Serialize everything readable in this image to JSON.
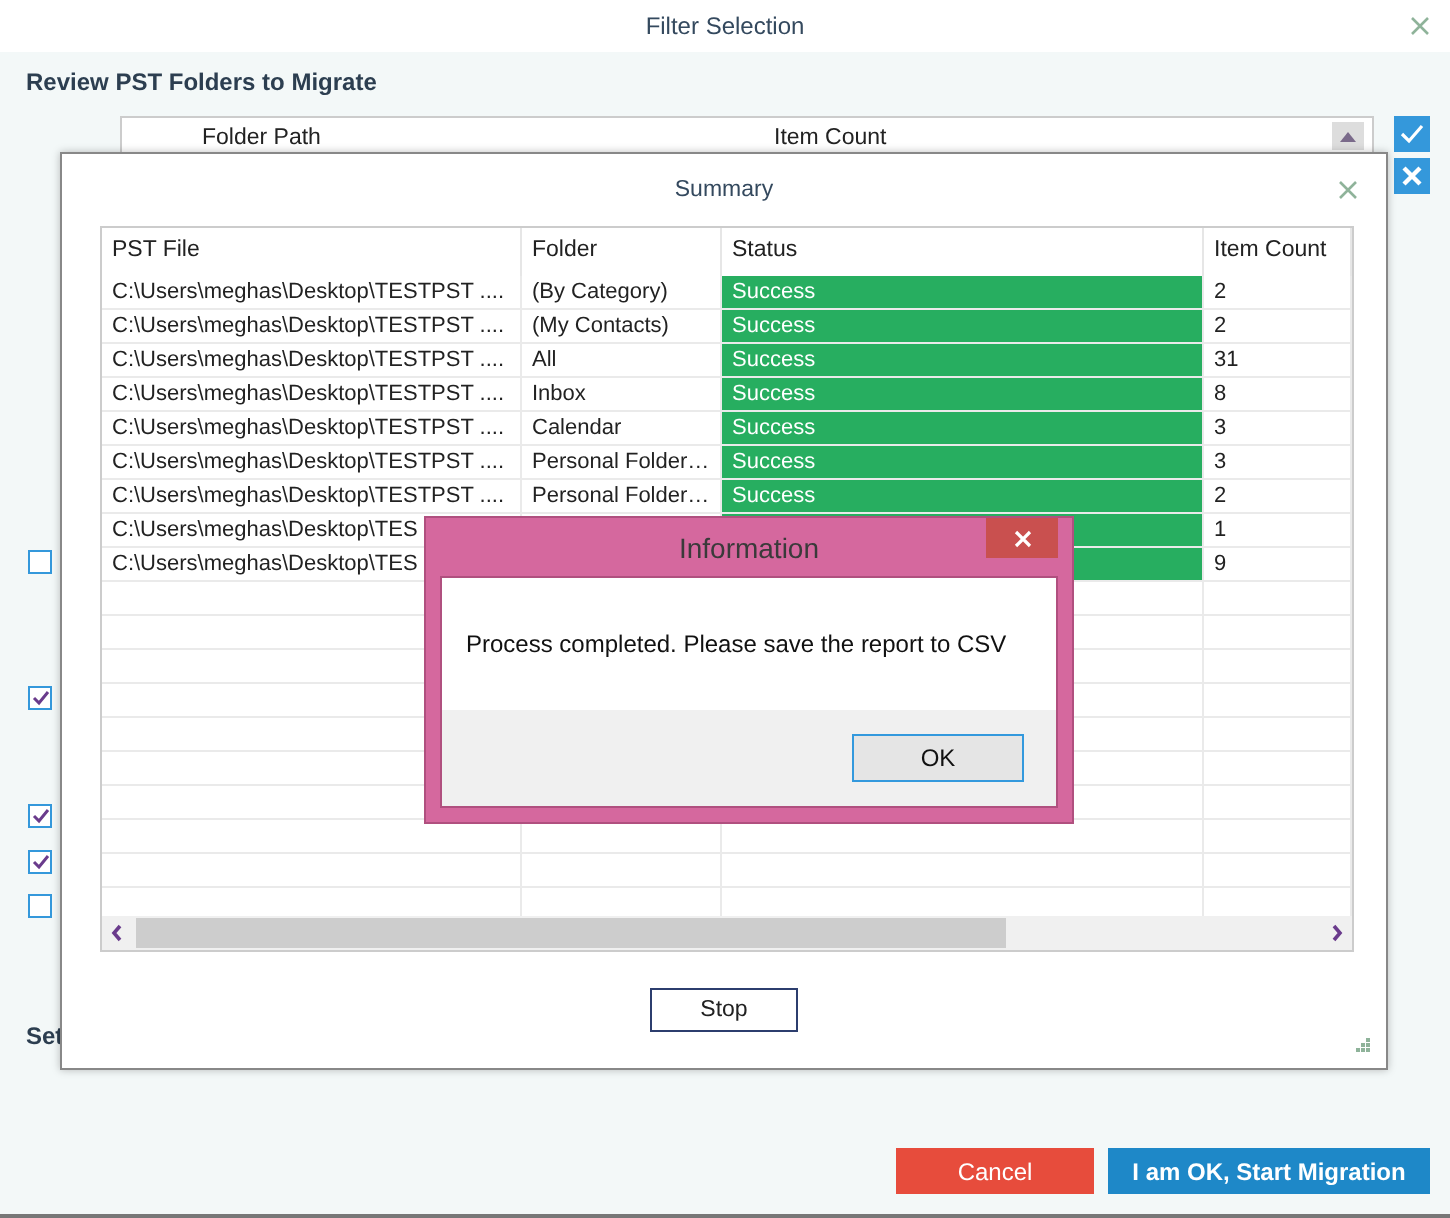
{
  "window": {
    "title": "Filter Selection"
  },
  "heading": "Review PST Folders to Migrate",
  "folder_table": {
    "columns": [
      "Folder Path",
      "Item Count"
    ]
  },
  "options": [
    {
      "checked": false
    },
    {
      "checked": true
    },
    {
      "checked": true
    },
    {
      "checked": true
    },
    {
      "checked": false
    }
  ],
  "section_label": "Set",
  "summary": {
    "title": "Summary",
    "columns": [
      "PST File",
      "Folder",
      "Status",
      "Item Count"
    ],
    "rows": [
      {
        "pst_file": "C:\\Users\\meghas\\Desktop\\TESTPST ....",
        "folder": "(By Category)",
        "status": "Success",
        "success": true,
        "item_count": "2"
      },
      {
        "pst_file": "C:\\Users\\meghas\\Desktop\\TESTPST ....",
        "folder": "(My Contacts)",
        "status": "Success",
        "success": true,
        "item_count": "2"
      },
      {
        "pst_file": "C:\\Users\\meghas\\Desktop\\TESTPST ....",
        "folder": "All",
        "status": "Success",
        "success": true,
        "item_count": "31"
      },
      {
        "pst_file": "C:\\Users\\meghas\\Desktop\\TESTPST ....",
        "folder": "Inbox",
        "status": "Success",
        "success": true,
        "item_count": "8"
      },
      {
        "pst_file": "C:\\Users\\meghas\\Desktop\\TESTPST ....",
        "folder": "Calendar",
        "status": "Success",
        "success": true,
        "item_count": "3"
      },
      {
        "pst_file": "C:\\Users\\meghas\\Desktop\\TESTPST ....",
        "folder": "Personal Folder…",
        "status": "Success",
        "success": true,
        "item_count": "3"
      },
      {
        "pst_file": "C:\\Users\\meghas\\Desktop\\TESTPST ....",
        "folder": "Personal Folder…",
        "status": "Success",
        "success": true,
        "item_count": "2"
      },
      {
        "pst_file": "C:\\Users\\meghas\\Desktop\\TES",
        "success": true,
        "item_count": "1"
      },
      {
        "pst_file": "C:\\Users\\meghas\\Desktop\\TES",
        "success": true,
        "item_count": "9"
      }
    ],
    "stop_button": "Stop"
  },
  "information": {
    "title": "Information",
    "message": "Process completed. Please save the report to CSV",
    "ok_button": "OK"
  },
  "buttons": [
    {
      "label": "Cancel",
      "kind": "cancel"
    },
    {
      "label": "I am OK, Start Migration",
      "kind": "primary"
    }
  ]
}
